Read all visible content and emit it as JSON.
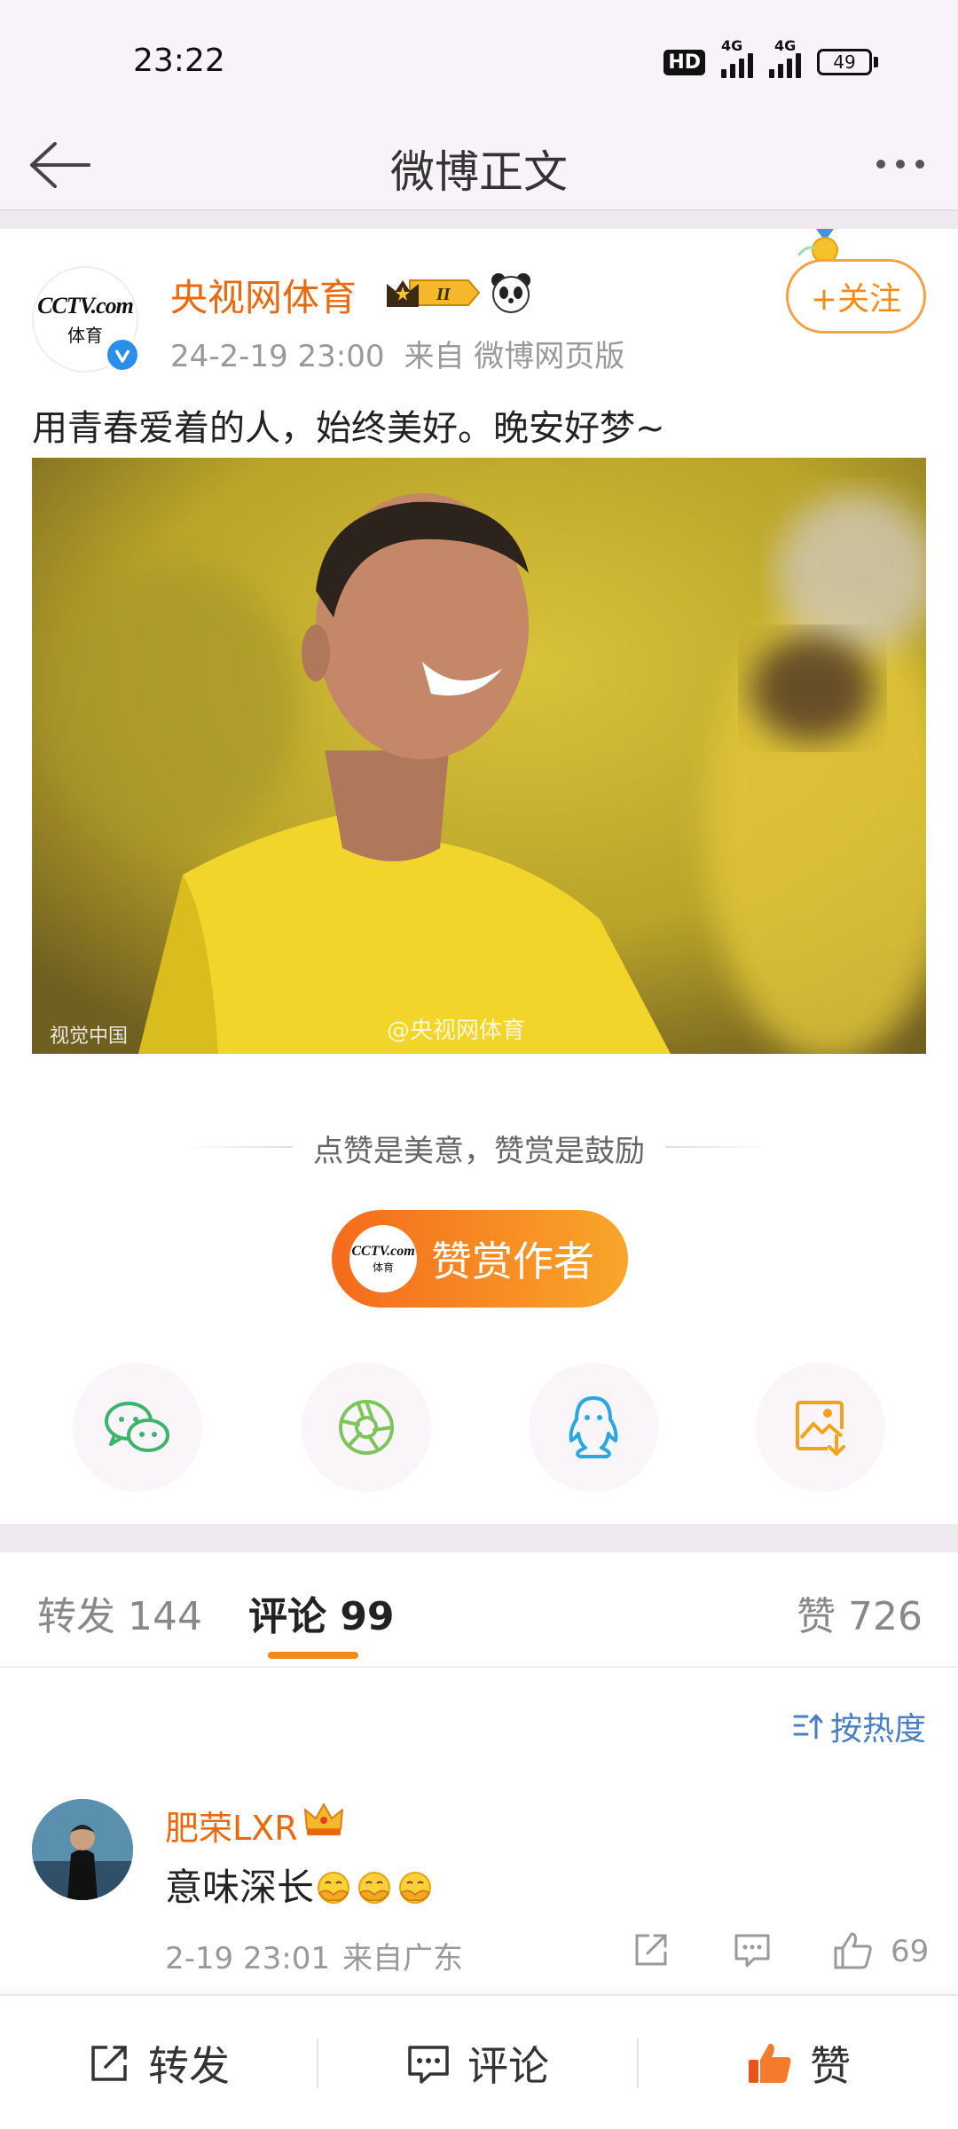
{
  "status_bar": {
    "time": "23:22",
    "hd_label": "HD",
    "signal1_label": "4G",
    "signal2_label": "4G",
    "battery": "49"
  },
  "header": {
    "title": "微博正文"
  },
  "post": {
    "author": "央视网体育",
    "time": "24-2-19 23:00",
    "source": "来自 微博网页版",
    "follow_label": "+关注",
    "text": "用青春爱着的人，始终美好。晚安好梦~",
    "image_credit": "视觉中国",
    "image_watermark": "@央视网体育",
    "avatar_logo": "CCTV.com",
    "avatar_sub": "体育"
  },
  "reward": {
    "tagline": "点赞是美意，赞赏是鼓励",
    "button_label": "赞赏作者"
  },
  "share": {
    "items": [
      "wechat-icon",
      "moments-icon",
      "qq-icon",
      "save-image-icon"
    ],
    "colors": {
      "wechat": "#3cb46e",
      "moments": "#7cc55a",
      "qq": "#2aa7e0",
      "save": "#f3a21d"
    }
  },
  "tabs": {
    "repost": "转发 144",
    "comments": "评论 99",
    "likes": "赞 726"
  },
  "sort": {
    "label": "按热度"
  },
  "comment": {
    "user": "肥荣LXR",
    "text": "意味深长",
    "time": "2-19 23:01",
    "location": "来自广东",
    "likes": "69"
  },
  "bottom_bar": {
    "repost": "转发",
    "comment": "评论",
    "like": "赞"
  },
  "colors": {
    "accent": "#f08c1a",
    "author": "#e9690e",
    "link": "#4a7fc4"
  }
}
